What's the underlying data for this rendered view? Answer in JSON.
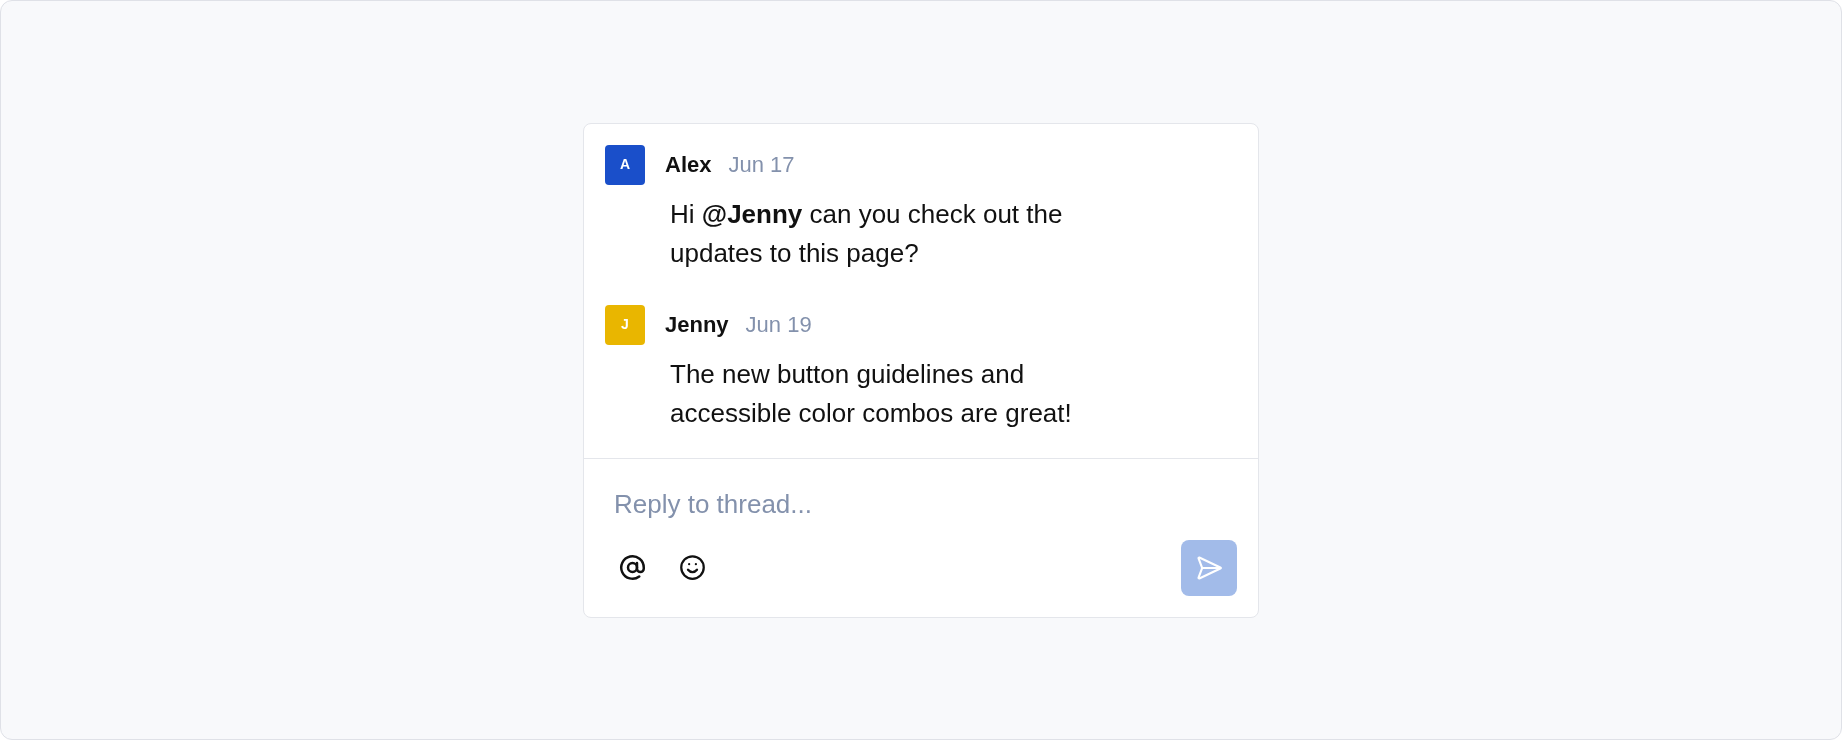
{
  "messages": [
    {
      "initial": "A",
      "color": "#1a4fca",
      "author": "Alex",
      "date": "Jun 17",
      "text": "Hi **@Jenny** can you check out the updates to this page?"
    },
    {
      "initial": "J",
      "color": "#e9b600",
      "author": "Jenny",
      "date": "Jun 19",
      "text": "The new button guidelines and accessible color combos are great!"
    }
  ],
  "reply": {
    "placeholder": "Reply to thread...",
    "send_button": {
      "disabled": true
    }
  }
}
